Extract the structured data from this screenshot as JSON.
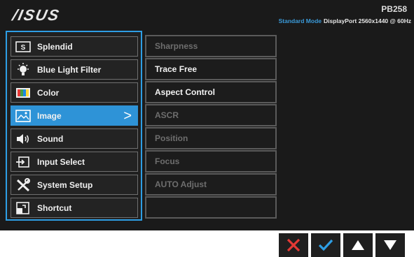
{
  "header": {
    "brand": "/ISUS",
    "model": "PB258",
    "mode": "Standard Mode",
    "input_info": "DisplayPort  2560x1440 @ 60Hz"
  },
  "menu": {
    "items": [
      {
        "label": "Splendid",
        "icon": "splendid-icon"
      },
      {
        "label": "Blue Light Filter",
        "icon": "bulb-icon"
      },
      {
        "label": "Color",
        "icon": "color-icon"
      },
      {
        "label": "Image",
        "icon": "image-icon",
        "selected": true
      },
      {
        "label": "Sound",
        "icon": "speaker-icon"
      },
      {
        "label": "Input Select",
        "icon": "input-icon"
      },
      {
        "label": "System Setup",
        "icon": "wrench-icon"
      },
      {
        "label": "Shortcut",
        "icon": "shortcut-icon"
      }
    ],
    "selected_chevron": ">"
  },
  "submenu": {
    "items": [
      {
        "label": "Sharpness",
        "enabled": false
      },
      {
        "label": "Trace Free",
        "enabled": true
      },
      {
        "label": "Aspect Control",
        "enabled": true
      },
      {
        "label": "ASCR",
        "enabled": false
      },
      {
        "label": "Position",
        "enabled": false
      },
      {
        "label": "Focus",
        "enabled": false
      },
      {
        "label": "AUTO Adjust",
        "enabled": false
      },
      {
        "label": "",
        "enabled": false
      }
    ]
  },
  "buttons": {
    "close_icon": "close-icon",
    "confirm_icon": "check-icon",
    "up_icon": "up-arrow-icon",
    "down_icon": "down-arrow-icon"
  },
  "colors": {
    "accent": "#2e93d7",
    "close": "#e53935",
    "check": "#2e9ee4"
  }
}
